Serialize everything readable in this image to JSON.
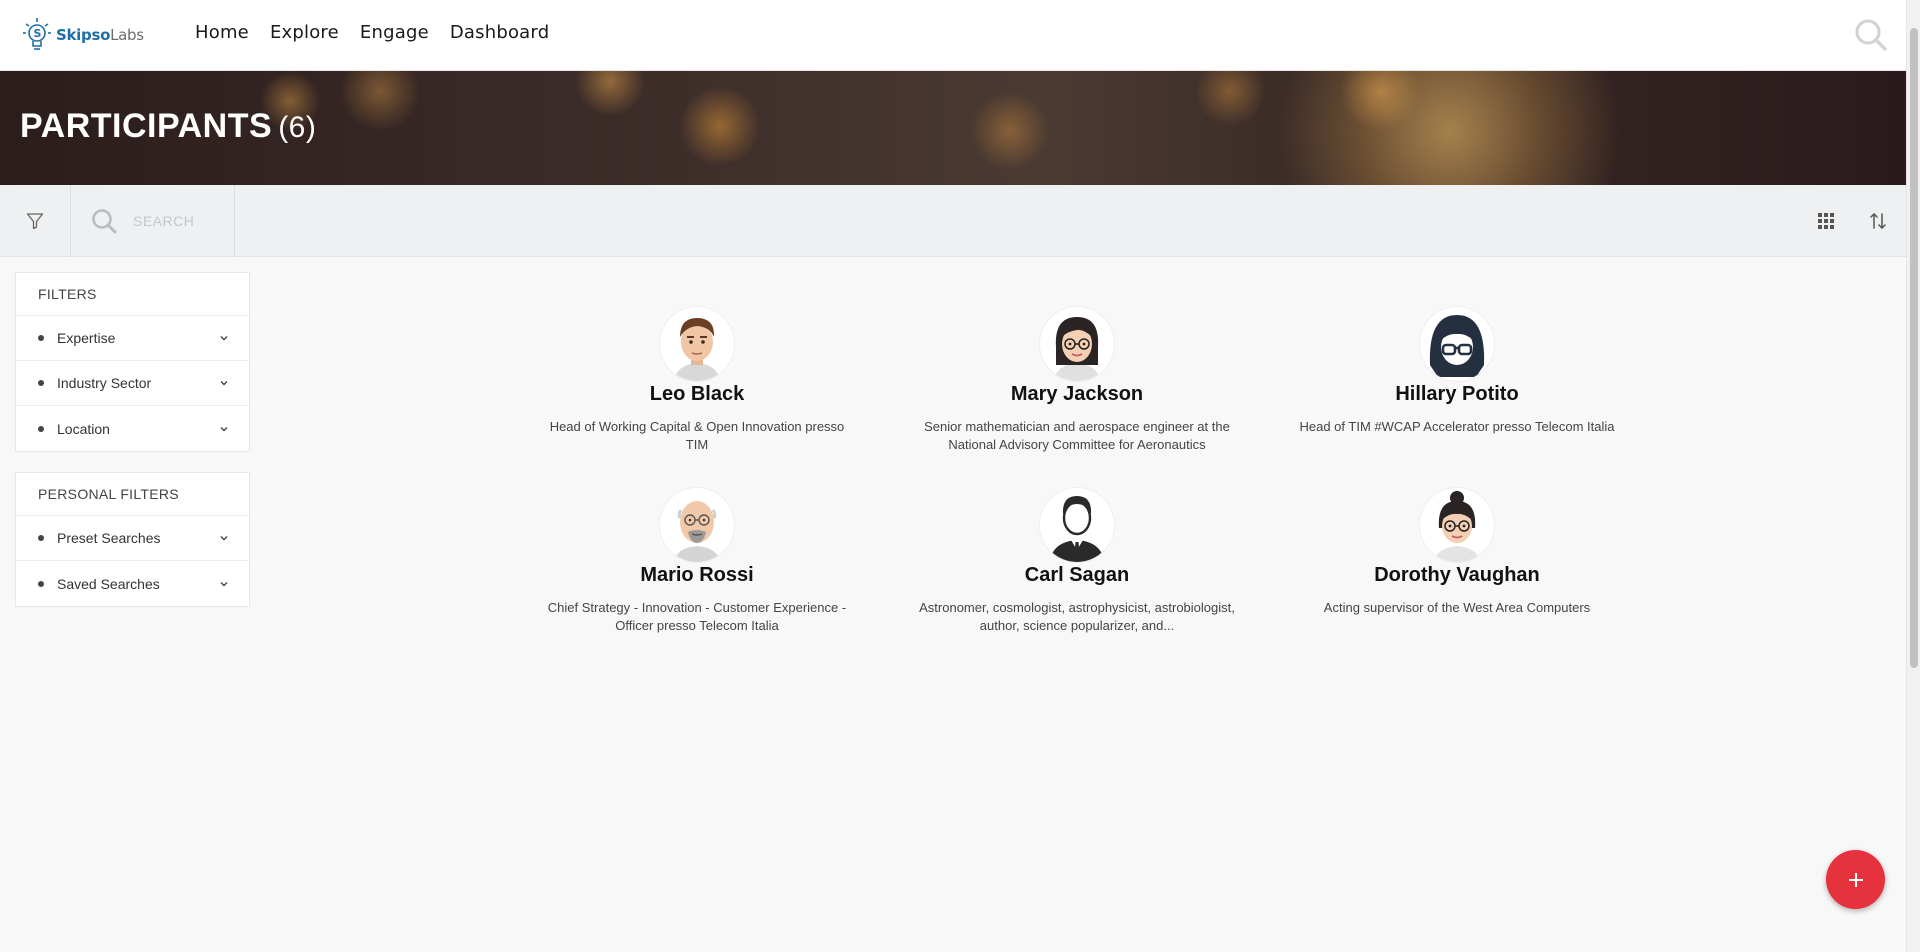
{
  "brand": {
    "logo_part1": "Skipso",
    "logo_part2": "Labs",
    "logo_icon": "lightbulb-logo-icon"
  },
  "nav": {
    "items": [
      {
        "label": "Home"
      },
      {
        "label": "Explore"
      },
      {
        "label": "Engage"
      },
      {
        "label": "Dashboard"
      }
    ],
    "search_icon": "search-icon"
  },
  "hero": {
    "title": "PARTICIPANTS",
    "count": "(6)"
  },
  "toolbar": {
    "filter_icon": "funnel-icon",
    "search_icon": "search-icon",
    "search_placeholder": "SEARCH",
    "search_value": "",
    "grid_icon": "grid-view-icon",
    "sort_icon": "sort-icon"
  },
  "filters": {
    "title": "FILTERS",
    "items": [
      {
        "label": "Expertise"
      },
      {
        "label": "Industry Sector"
      },
      {
        "label": "Location"
      }
    ]
  },
  "personal_filters": {
    "title": "PERSONAL FILTERS",
    "items": [
      {
        "label": "Preset Searches"
      },
      {
        "label": "Saved Searches"
      }
    ]
  },
  "participants": [
    {
      "name": "Leo Black",
      "description": "Head of Working Capital & Open Innovation presso TIM",
      "avatar": "man-brown-hair-avatar"
    },
    {
      "name": "Mary Jackson",
      "description": "Senior mathematician and aerospace engineer at the National Advisory Committee for Aeronautics",
      "avatar": "woman-glasses-avatar"
    },
    {
      "name": "Hillary Potito",
      "description": "Head of TIM #WCAP Accelerator presso Telecom Italia",
      "avatar": "dark-hair-glasses-avatar"
    },
    {
      "name": "Mario Rossi",
      "description": "Chief Strategy - Innovation - Customer Experience - Officer presso Telecom Italia",
      "avatar": "bald-man-glasses-avatar"
    },
    {
      "name": "Carl Sagan",
      "description": "Astronomer, cosmologist, astrophysicist, astrobiologist, author, science popularizer, and...",
      "avatar": "man-suit-avatar"
    },
    {
      "name": "Dorothy Vaughan",
      "description": "Acting supervisor of the West Area Computers",
      "avatar": "woman-bun-glasses-avatar"
    }
  ],
  "fab": {
    "label": "+",
    "icon": "plus-icon"
  },
  "colors": {
    "accent_red": "#e5323c",
    "brand_blue": "#1f6fa6",
    "toolbar_bg": "#eef0f1"
  }
}
